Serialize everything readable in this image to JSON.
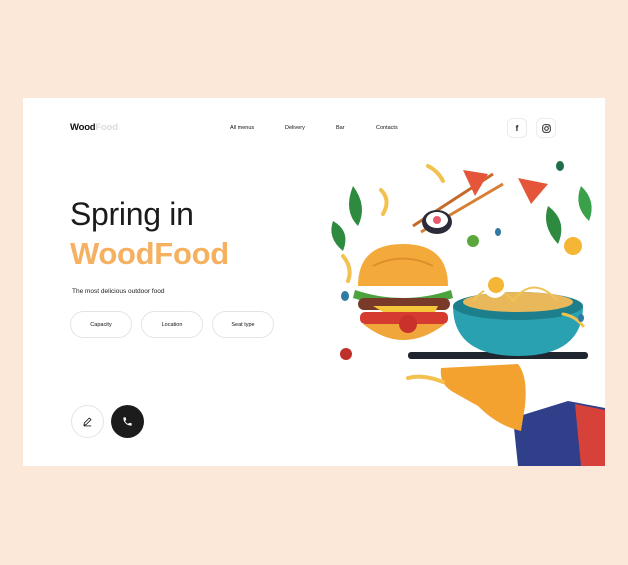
{
  "brand": {
    "part1": "Wood",
    "part2": "Food"
  },
  "nav": [
    "All menus",
    "Delivery",
    "Bar",
    "Contacts"
  ],
  "social": {
    "facebook_label": "f",
    "instagram_icon": "instagram-icon"
  },
  "hero": {
    "line1": "Spring in",
    "line2": "WoodFood",
    "tagline": "The most delicious outdoor food"
  },
  "filters": [
    "Capacity",
    "Location",
    "Seat type"
  ],
  "actions": {
    "edit_icon": "pencil-icon",
    "call_icon": "phone-icon"
  },
  "colors": {
    "background": "#fbe8d9",
    "accent": "#f5b060",
    "dark": "#1c1c1c"
  }
}
